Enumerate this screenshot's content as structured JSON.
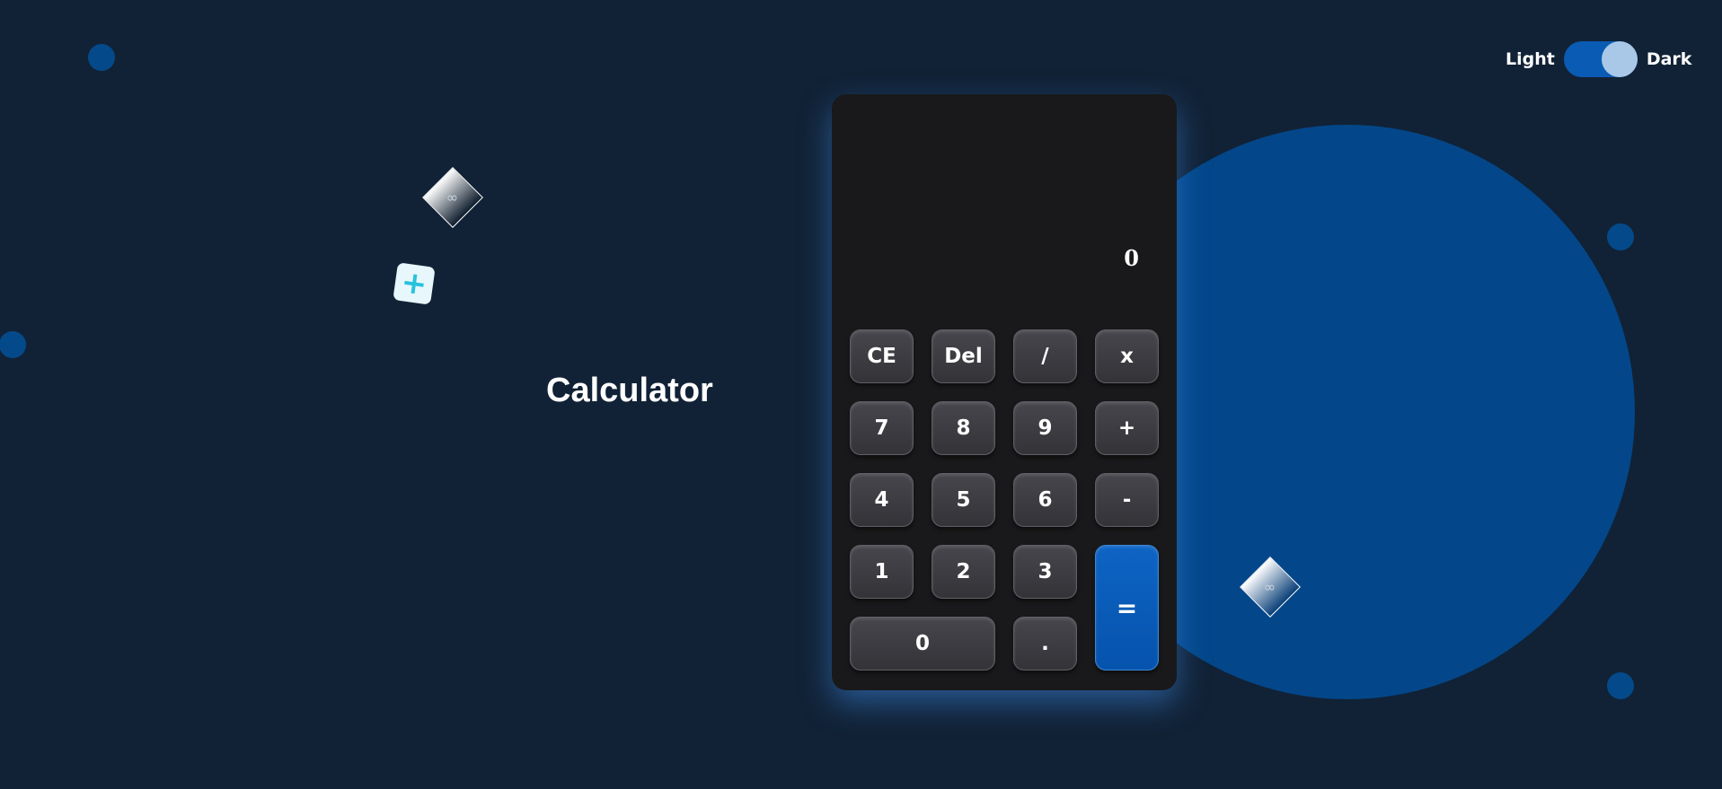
{
  "theme_toggle": {
    "light_label": "Light",
    "dark_label": "Dark",
    "selected": "Dark"
  },
  "title": "Calculator",
  "display": {
    "value": "0"
  },
  "keys": {
    "ce": "CE",
    "del": "Del",
    "divide": "/",
    "multiply": "x",
    "seven": "7",
    "eight": "8",
    "nine": "9",
    "plus": "+",
    "four": "4",
    "five": "5",
    "six": "6",
    "minus": "-",
    "one": "1",
    "two": "2",
    "three": "3",
    "zero": "0",
    "dot": ".",
    "equals": "="
  },
  "decorations": {
    "diamond_glyph": "∞",
    "plus_tile_glyph": "+"
  },
  "colors": {
    "background": "#112236",
    "accent": "#0553ad",
    "circle": "#03478a",
    "calculator_body": "#19191b",
    "key": "#3a3a3f"
  },
  "icons": {
    "plus_tile": "plus-icon",
    "diamond": "infinity-icon"
  }
}
